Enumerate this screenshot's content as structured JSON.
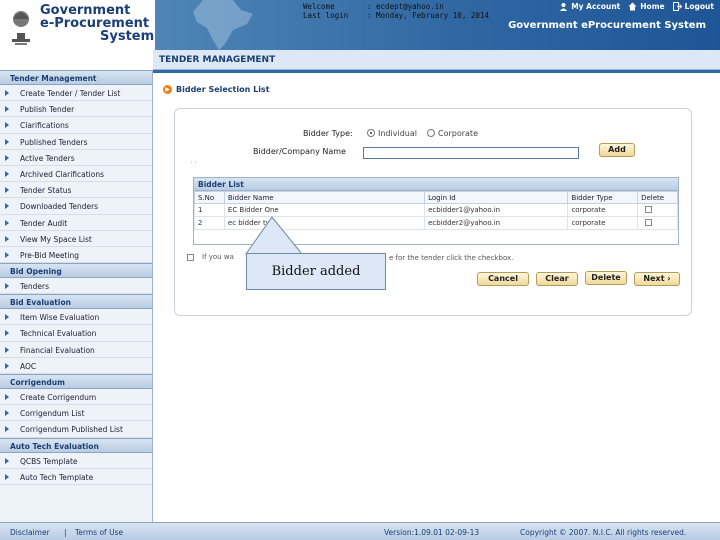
{
  "header": {
    "brand_lines": [
      "Government",
      "e-Procurement",
      "System"
    ],
    "welcome_label": "Welcome",
    "welcome_value": ": ecdept@yahoo.in",
    "lastlogin_label": "Last login",
    "lastlogin_value": ": Monday, February 10, 2014",
    "links": {
      "account": "My Account",
      "home": "Home",
      "logout": "Logout"
    },
    "system_title": "Government eProcurement System"
  },
  "main_title": "TENDER MANAGEMENT",
  "sidebar": {
    "sections": [
      {
        "title": "Tender Management",
        "items": [
          "Create Tender / Tender List",
          "Publish Tender",
          "Clarifications",
          "Published Tenders",
          "Active Tenders",
          "Archived Clarifications",
          "Tender Status",
          "Downloaded Tenders",
          "Tender Audit",
          "View My Space List",
          "Pre-Bid Meeting"
        ]
      },
      {
        "title": "Bid Opening",
        "items": [
          "Tenders"
        ]
      },
      {
        "title": "Bid Evaluation",
        "items": [
          "Item Wise Evaluation",
          "Technical Evaluation",
          "Financial Evaluation",
          "AOC"
        ]
      },
      {
        "title": "Corrigendum",
        "items": [
          "Create Corrigendum",
          "Corrigendum List",
          "Corrigendum Published List"
        ]
      },
      {
        "title": "Auto Tech Evaluation",
        "items": [
          "QCBS Template",
          "Auto Tech Template"
        ]
      }
    ]
  },
  "form": {
    "section_title": "Bidder Selection List",
    "bidder_type_label": "Bidder Type:",
    "radio_individual": "Individual",
    "radio_corporate": "Corporate",
    "company_label": "Bidder/Company Name",
    "company_value": "",
    "add_button": "Add",
    "tick": "' '"
  },
  "bidder_list": {
    "title": "Bidder List",
    "columns": [
      "S.No",
      "Bidder Name",
      "Login Id",
      "Bidder Type",
      "Delete"
    ],
    "rows": [
      [
        "1",
        "EC Bidder One",
        "ecbidder1@yahoo.in",
        "corporate"
      ],
      [
        "2",
        "ec bidder two",
        "ecbidder2@yahoo.in",
        "corporate"
      ]
    ]
  },
  "notice": {
    "prefix": "If you wa",
    "suffix": "e for the tender click the checkbox."
  },
  "buttons": {
    "cancel": "Cancel",
    "clear": "Clear",
    "delete": "Delete",
    "next": "Next ›"
  },
  "callout": "Bidder added",
  "footer": {
    "disclaimer": "Disclaimer",
    "terms": "Terms of Use",
    "version": "Version:1.09.01 02-09-13",
    "copyright": "Copyright © 2007. N.I.C. All rights reserved."
  },
  "colors": {
    "brand_blue": "#1c3f73",
    "banner": "#2f67a3",
    "button": "#efd89b",
    "accent_orange": "#e97d1c"
  }
}
